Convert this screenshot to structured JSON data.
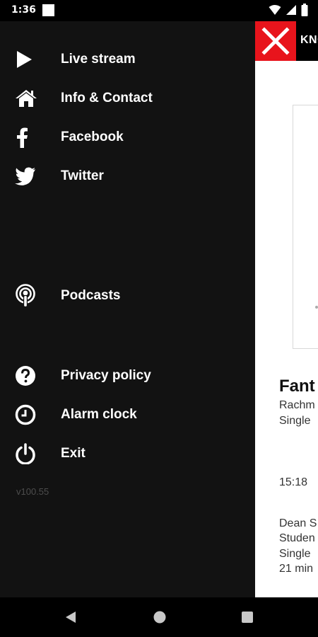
{
  "status_bar": {
    "time": "1:36",
    "icons": [
      "notification-square-icon",
      "wifi-icon",
      "signal-icon",
      "battery-icon"
    ]
  },
  "drawer": {
    "items": [
      {
        "label": "Live stream",
        "icon": "play-icon"
      },
      {
        "label": "Info & Contact",
        "icon": "home-icon"
      },
      {
        "label": "Facebook",
        "icon": "facebook-icon"
      },
      {
        "label": "Twitter",
        "icon": "twitter-icon"
      },
      {
        "label": "Podcasts",
        "icon": "podcast-icon"
      },
      {
        "label": "Privacy policy",
        "icon": "help-icon"
      },
      {
        "label": "Alarm clock",
        "icon": "alarm-clock-icon"
      },
      {
        "label": "Exit",
        "icon": "power-icon"
      }
    ],
    "version": "v100.55"
  },
  "main": {
    "header_text": "KNO",
    "now_playing": {
      "title": "Fant",
      "line1": "Rachm",
      "line2": "Single"
    },
    "next": {
      "time": "15:18",
      "line1": "Dean S",
      "line2": "Studen",
      "line3": "Single",
      "line4": "21 min"
    }
  },
  "colors": {
    "drawer_bg": "#121212",
    "close_red": "#e8141c",
    "version_text": "#4d4d4d"
  }
}
